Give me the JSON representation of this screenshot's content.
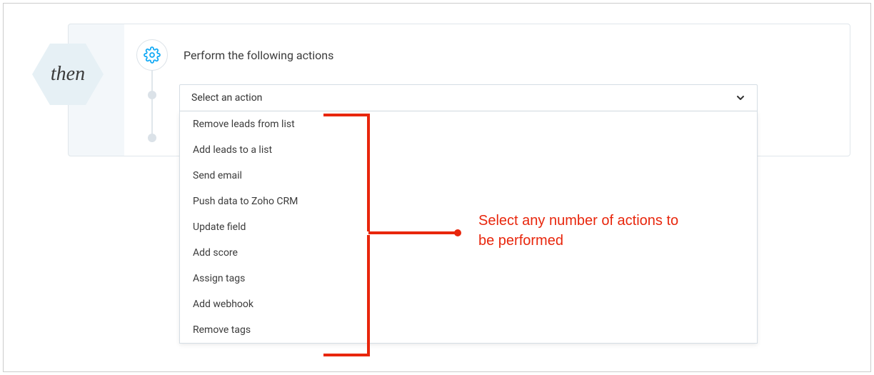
{
  "step": {
    "badge_label": "then",
    "title": "Perform the following actions"
  },
  "dropdown": {
    "placeholder": "Select an action",
    "options": [
      "Remove leads from list",
      "Add leads to a list",
      "Send email",
      "Push data to Zoho CRM",
      "Update field",
      "Add score",
      "Assign tags",
      "Add webhook",
      "Remove tags"
    ]
  },
  "annotation": {
    "text": "Select any number of actions to be performed"
  }
}
